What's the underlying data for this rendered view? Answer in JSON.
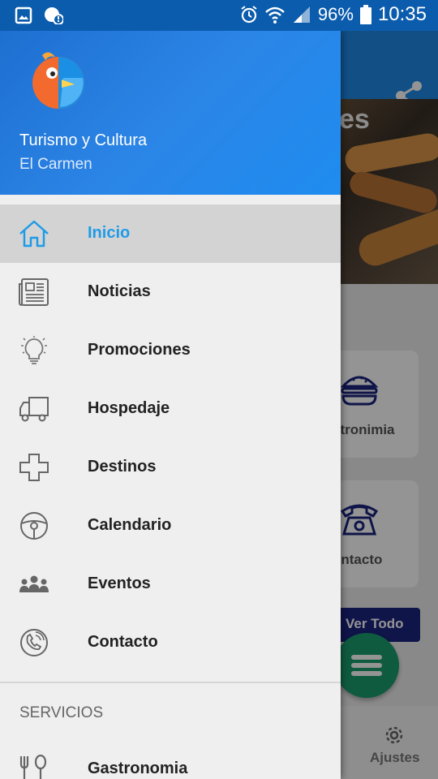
{
  "status_bar": {
    "battery": "96%",
    "time": "10:35",
    "icons": [
      "image-icon",
      "chat-alert-icon",
      "alarm-icon",
      "wifi-icon",
      "signal-icon",
      "battery-icon"
    ]
  },
  "background": {
    "banner_text": "es",
    "card1_label": "stronimia",
    "card2_label": "ontacto",
    "ver_todo": "Ver Todo",
    "bottom_nav_ajustes": "Ajustes"
  },
  "drawer": {
    "header": {
      "title": "Turismo y Cultura",
      "subtitle": "El Carmen"
    },
    "items": [
      {
        "label": "Inicio",
        "icon": "home-icon",
        "active": true
      },
      {
        "label": "Noticias",
        "icon": "newspaper-icon"
      },
      {
        "label": "Promociones",
        "icon": "lightbulb-icon"
      },
      {
        "label": "Hospedaje",
        "icon": "truck-icon"
      },
      {
        "label": "Destinos",
        "icon": "plus-cross-icon"
      },
      {
        "label": "Calendario",
        "icon": "steering-wheel-icon"
      },
      {
        "label": "Eventos",
        "icon": "people-group-icon"
      },
      {
        "label": "Contacto",
        "icon": "phone-icon"
      }
    ],
    "section_title": "SERVICIOS",
    "services": [
      {
        "label": "Gastronomia",
        "icon": "fork-spoon-icon"
      }
    ]
  },
  "colors": {
    "status_bar": "#0b5cad",
    "header_blue": "#2b85e6",
    "active_text": "#1e9be8",
    "fab_green": "#1b9e6e",
    "ver_todo_bg": "#1a237e"
  }
}
